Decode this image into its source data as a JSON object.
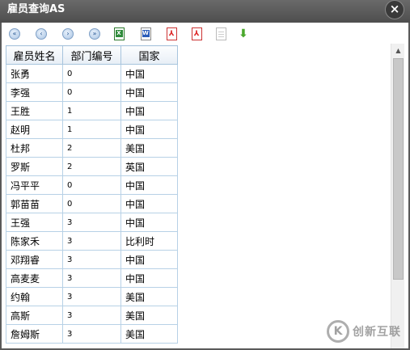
{
  "window": {
    "title": "雇员查询AS",
    "close_label": "×"
  },
  "toolbar": {
    "items": [
      {
        "name": "first-page-button",
        "icon": "double-left-arrow-icon",
        "glyph": "«"
      },
      {
        "name": "prev-page-button",
        "icon": "left-arrow-icon",
        "glyph": "‹"
      },
      {
        "name": "next-page-button",
        "icon": "right-arrow-icon",
        "glyph": "›"
      },
      {
        "name": "last-page-button",
        "icon": "double-right-arrow-icon",
        "glyph": "»"
      },
      {
        "name": "export-excel-button",
        "icon": "excel-icon",
        "glyph": "X"
      },
      {
        "name": "export-word-button",
        "icon": "word-icon",
        "glyph": "W"
      },
      {
        "name": "export-pdf-button",
        "icon": "pdf-icon",
        "glyph": "⅄"
      },
      {
        "name": "print-pdf-button",
        "icon": "pdf-icon",
        "glyph": "⅄"
      },
      {
        "name": "export-text-button",
        "icon": "blank-document-icon",
        "glyph": ""
      },
      {
        "name": "download-button",
        "icon": "download-arrow-icon",
        "glyph": "⬇"
      }
    ]
  },
  "table": {
    "headers": [
      "雇员姓名",
      "部门编号",
      "国家"
    ],
    "rows": [
      [
        "张勇",
        "0",
        "中国"
      ],
      [
        "李强",
        "0",
        "中国"
      ],
      [
        "王胜",
        "1",
        "中国"
      ],
      [
        "赵明",
        "1",
        "中国"
      ],
      [
        "杜邦",
        "2",
        "美国"
      ],
      [
        "罗斯",
        "2",
        "英国"
      ],
      [
        "冯平平",
        "0",
        "中国"
      ],
      [
        "郭苗苗",
        "0",
        "中国"
      ],
      [
        "王强",
        "3",
        "中国"
      ],
      [
        "陈家禾",
        "3",
        "比利时"
      ],
      [
        "邓翔睿",
        "3",
        "中国"
      ],
      [
        "高麦麦",
        "3",
        "中国"
      ],
      [
        "约翰",
        "3",
        "美国"
      ],
      [
        "高斯",
        "3",
        "美国"
      ],
      [
        "詹姆斯",
        "3",
        "美国"
      ]
    ]
  },
  "scrollbar": {
    "up_arrow": "▲"
  },
  "watermark": {
    "logo": "K",
    "text": "创新互联"
  }
}
